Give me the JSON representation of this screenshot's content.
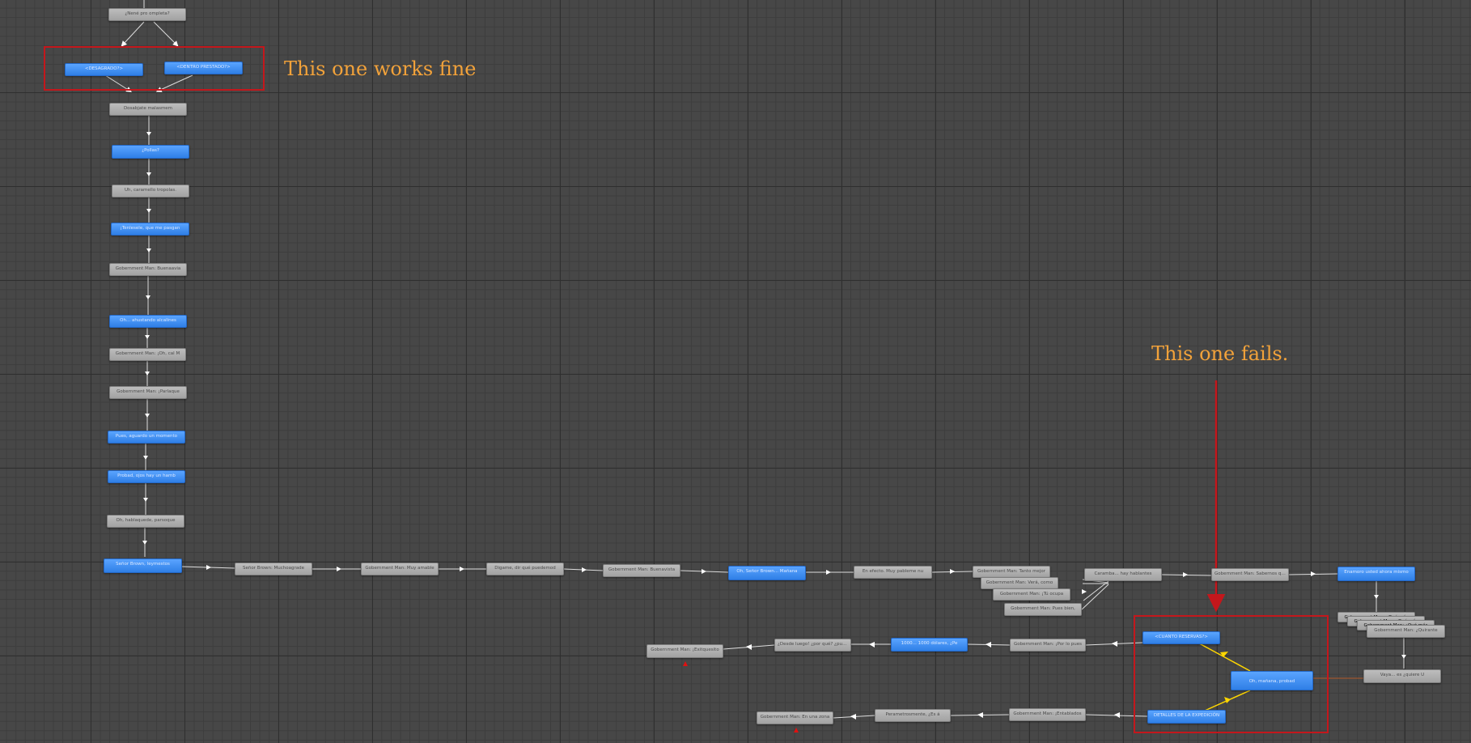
{
  "annotations": {
    "works": "This one works fine",
    "fails": "This one fails."
  },
  "colors": {
    "canvas": "#474747",
    "blue_node": "#3b8cf2",
    "gray_node": "#b0b0b0",
    "highlight_red": "#c4171c",
    "annotation_orange": "#f2a23a",
    "wire_white": "#ffffff",
    "wire_yellow": "#ffd700"
  },
  "graph": {
    "vertical_chain": [
      {
        "label": "¿Nené pro ompleta?",
        "style": "gray"
      },
      {
        "label": "<DESAGRADO?>",
        "style": "blue"
      },
      {
        "label": "<DENTRO PRESTADO?>",
        "style": "blue"
      },
      {
        "label": "Dosabjate malasmem",
        "style": "gray"
      },
      {
        "label": "¿Pollas?",
        "style": "blue"
      },
      {
        "label": "Uh, caramello tropolas.",
        "style": "gray"
      },
      {
        "label": "¡Tenlesele, que me pasgan",
        "style": "blue"
      },
      {
        "label": "Gobernment Man: Buenaavia",
        "style": "gray"
      },
      {
        "label": "Oh... ahustando alcalines",
        "style": "blue"
      },
      {
        "label": "Gobernment Man: ¡Oh, cal M",
        "style": "gray"
      },
      {
        "label": "Gobernment Man: ¡Parlaque",
        "style": "gray"
      },
      {
        "label": "Pues, aguardo un momento",
        "style": "blue"
      },
      {
        "label": "Probad, ojos hay un hamb",
        "style": "blue"
      },
      {
        "label": "Oh, hablaquede, parsoque",
        "style": "gray"
      },
      {
        "label": "Señor Brown, leymestos",
        "style": "blue"
      }
    ],
    "horizontal_chain": [
      {
        "label": "Señor Brown: Muchoagrade",
        "style": "gray"
      },
      {
        "label": "Gobernment Man: Muy amable",
        "style": "gray"
      },
      {
        "label": "Digame, dir qué puedemod",
        "style": "gray"
      },
      {
        "label": "Gobernment Man: Buenavista",
        "style": "gray"
      },
      {
        "label": "Oh, Señor Brown... Mañana",
        "style": "blue"
      },
      {
        "label": "En efecto. Muy pableme nu",
        "style": "gray"
      },
      {
        "label": "Gobernment Man: Tanto mejor",
        "style": "gray"
      },
      {
        "label": "Gobernment Man: Verá, como",
        "style": "gray"
      },
      {
        "label": "Gobernment Man: ¡Tú ocupa",
        "style": "gray"
      },
      {
        "label": "Gobernment Man: Pues bien,",
        "style": "gray"
      },
      {
        "label": "Caramba... hay hablantes",
        "style": "gray"
      },
      {
        "label": "Gobernment Man: Sabernos que",
        "style": "gray"
      },
      {
        "label": "Enamoro usted ahora mismo",
        "style": "blue"
      }
    ],
    "right_cluster": [
      {
        "label": "Gobernment Man: ¿Qué más",
        "style": "gray"
      },
      {
        "label": "Gobernment Man: ¿Qué más",
        "style": "gray"
      },
      {
        "label": "Gobernment Man: ¿Qué más",
        "style": "gray"
      },
      {
        "label": "Gobernment Man: ¿Quirante",
        "style": "gray"
      },
      {
        "label": "Vaya... es ¿quiere U",
        "style": "gray"
      }
    ],
    "bottom_chain_upper": [
      {
        "label": "<CUANTO RESERVAS?>",
        "style": "blue"
      },
      {
        "label": "Gobernment Man: ¡Por lo pues",
        "style": "gray"
      },
      {
        "label": "1000... 1000 dólares, ¿Pe",
        "style": "blue"
      },
      {
        "label": "¿Desde luego! ¿por qué? ¿puede",
        "style": "gray"
      },
      {
        "label": "Gobernment Man: ¡Exitquesito",
        "style": "gray"
      }
    ],
    "bottom_center": {
      "label": "Oh, mañana, probad",
      "style": "blue"
    },
    "bottom_chain_lower": [
      {
        "label": "DETALLES DE LA EXPEDICIÓN",
        "style": "blue"
      },
      {
        "label": "Gobernment Man: ¡Entablados",
        "style": "gray"
      },
      {
        "label": "Perametrosmente, ¿Es á",
        "style": "gray"
      },
      {
        "label": "Gobernment Man: En una zona",
        "style": "gray"
      }
    ]
  }
}
